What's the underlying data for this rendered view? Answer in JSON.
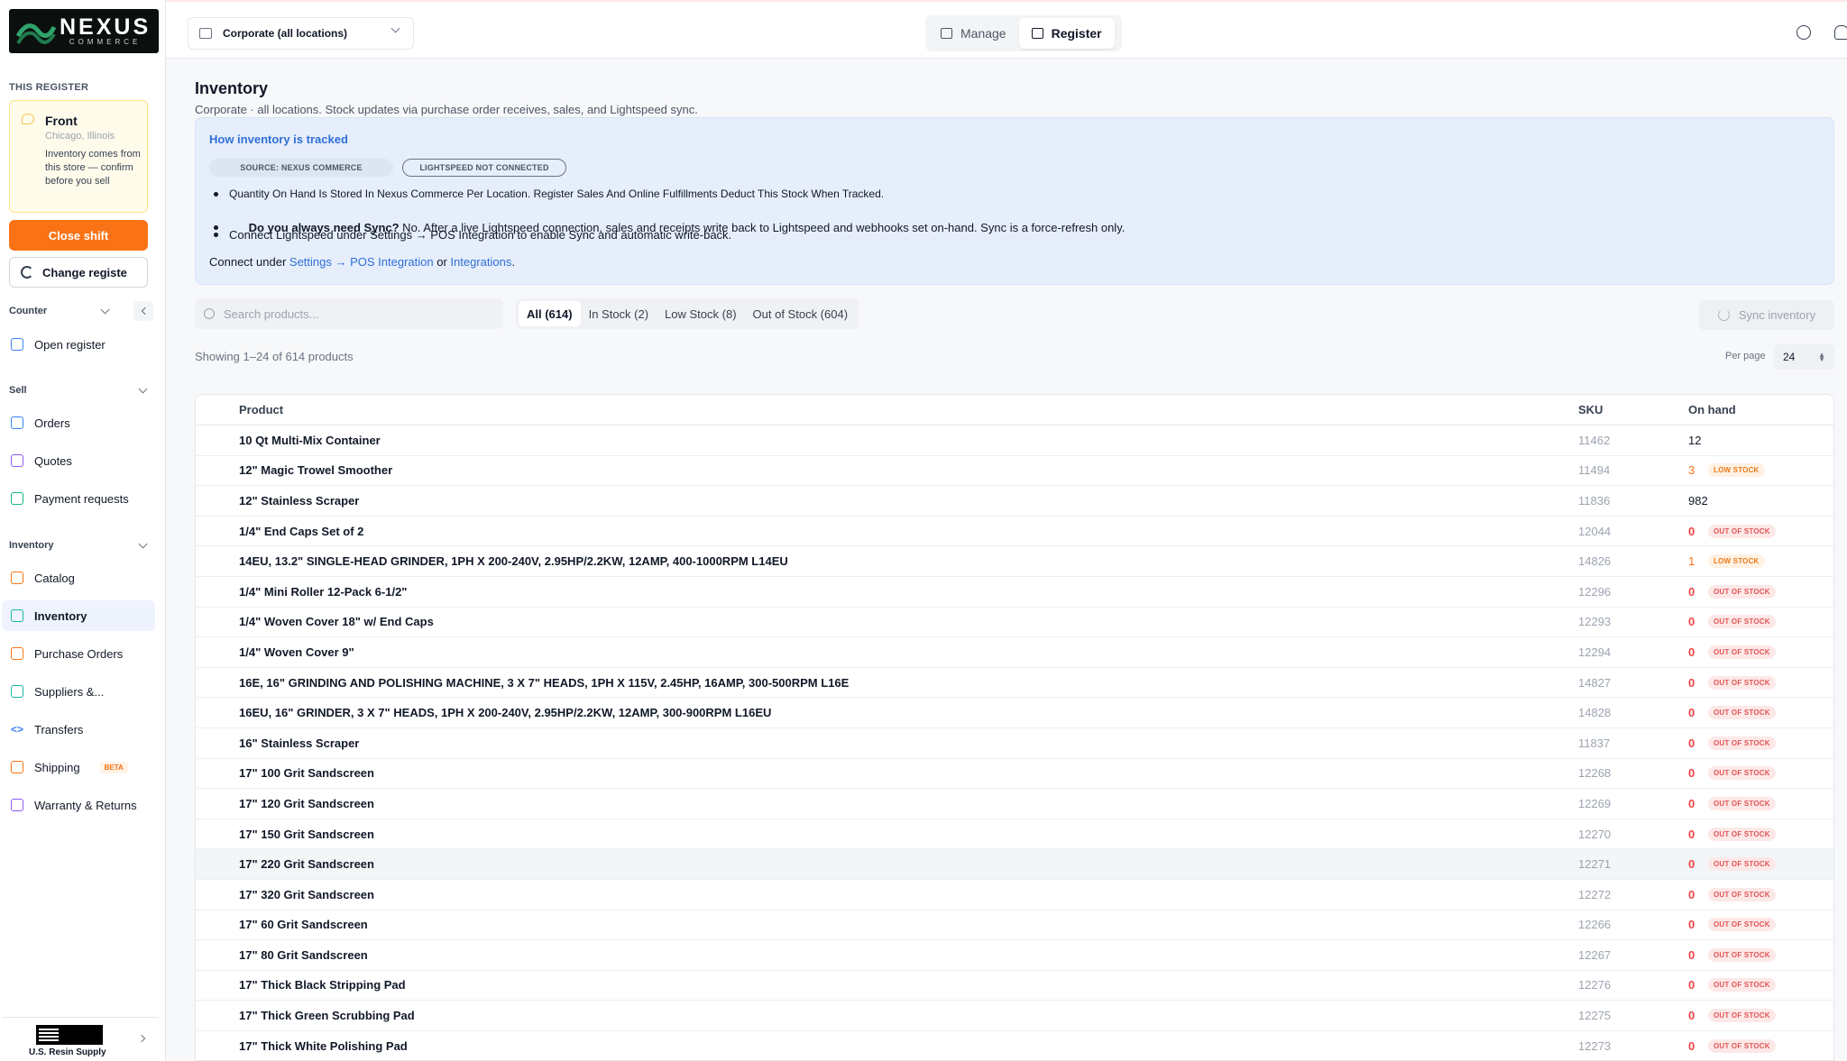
{
  "brand": {
    "name": "NEXUS",
    "sub": "COMMERCE"
  },
  "sidebar": {
    "this_register_label": "THIS REGISTER",
    "register": {
      "name": "Front",
      "location": "Chicago, Illinois",
      "note": "Inventory comes from this store — confirm before you sell"
    },
    "close_shift": "Close shift",
    "change_register": "Change registe",
    "groups": {
      "counter": "Counter",
      "sell": "Sell",
      "inventory": "Inventory"
    },
    "items": [
      {
        "label": "Open register"
      },
      {
        "label": "Orders"
      },
      {
        "label": "Quotes"
      },
      {
        "label": "Payment requests"
      },
      {
        "label": "Catalog"
      },
      {
        "label": "Inventory"
      },
      {
        "label": "Purchase Orders"
      },
      {
        "label": "Suppliers &..."
      },
      {
        "label": "Transfers"
      },
      {
        "label": "Shipping"
      },
      {
        "label": "Warranty & Returns"
      }
    ],
    "shipping_badge": "BETA",
    "company_name": "U.S. Resin Supply"
  },
  "topbar": {
    "location": "Corporate (all locations)",
    "modes": [
      "Manage",
      "Register"
    ],
    "active_mode": "Register"
  },
  "page": {
    "title": "Inventory",
    "subtitle": "Corporate · all locations. Stock updates via purchase order receives, sales, and Lightspeed sync."
  },
  "info": {
    "title": "How inventory is tracked",
    "chip_source": "SOURCE: NEXUS COMMERCE",
    "chip_lightspeed": "LIGHTSPEED NOT CONNECTED",
    "bullet1": "Quantity On Hand Is Stored In Nexus Commerce Per Location. Register Sales And Online Fulfillments Deduct This Stock When Tracked.",
    "bullet2_bold": "Do you always need Sync?",
    "bullet2_rest": " No. After a live Lightspeed connection, sales and receipts write back to Lightspeed and webhooks set on-hand. Sync is a force-refresh only.",
    "bullet3": "Connect Lightspeed under Settings → POS Integration to enable Sync and automatic write-back.",
    "connect_prefix": "Connect under ",
    "connect_link1": "Settings → POS Integration",
    "connect_or": " or ",
    "connect_link2": "Integrations",
    "connect_suffix": "."
  },
  "search": {
    "placeholder": "Search products..."
  },
  "filters": [
    "All (614)",
    "In Stock (2)",
    "Low Stock (8)",
    "Out of Stock (604)"
  ],
  "active_filter": "All (614)",
  "sync_label": "Sync inventory",
  "showing": "Showing 1–24 of 614 products",
  "per_page_label": "Per page",
  "per_page_value": "24",
  "table": {
    "headers": {
      "product": "Product",
      "sku": "SKU",
      "on_hand": "On hand"
    },
    "rows": [
      {
        "product": "10 Qt Multi-Mix Container",
        "sku": "11462",
        "qty": "12",
        "status": "ok",
        "badge": ""
      },
      {
        "product": "12\" Magic Trowel Smoother",
        "sku": "11494",
        "qty": "3",
        "status": "low",
        "badge": "LOW STOCK"
      },
      {
        "product": "12\" Stainless Scraper",
        "sku": "11836",
        "qty": "982",
        "status": "ok",
        "badge": ""
      },
      {
        "product": "1/4\" End Caps Set of 2",
        "sku": "12044",
        "qty": "0",
        "status": "out",
        "badge": "OUT OF STOCK"
      },
      {
        "product": "14EU, 13.2\" SINGLE-HEAD GRINDER, 1PH X 200-240V, 2.95HP/2.2KW, 12AMP, 400-1000RPM L14EU",
        "sku": "14826",
        "qty": "1",
        "status": "low",
        "badge": "LOW STOCK"
      },
      {
        "product": "1/4\" Mini Roller 12-Pack 6-1/2\"",
        "sku": "12296",
        "qty": "0",
        "status": "out",
        "badge": "OUT OF STOCK"
      },
      {
        "product": "1/4\" Woven Cover 18\" w/ End Caps",
        "sku": "12293",
        "qty": "0",
        "status": "out",
        "badge": "OUT OF STOCK"
      },
      {
        "product": "1/4\" Woven Cover 9\"",
        "sku": "12294",
        "qty": "0",
        "status": "out",
        "badge": "OUT OF STOCK"
      },
      {
        "product": "16E, 16\" GRINDING AND POLISHING MACHINE, 3 X 7\" HEADS, 1PH X 115V, 2.45HP, 16AMP, 300-500RPM L16E",
        "sku": "14827",
        "qty": "0",
        "status": "out",
        "badge": "OUT OF STOCK"
      },
      {
        "product": "16EU, 16\" GRINDER, 3 X 7\" HEADS, 1PH X 200-240V, 2.95HP/2.2KW, 12AMP, 300-900RPM L16EU",
        "sku": "14828",
        "qty": "0",
        "status": "out",
        "badge": "OUT OF STOCK"
      },
      {
        "product": "16\" Stainless Scraper",
        "sku": "11837",
        "qty": "0",
        "status": "out",
        "badge": "OUT OF STOCK"
      },
      {
        "product": "17\" 100 Grit Sandscreen",
        "sku": "12268",
        "qty": "0",
        "status": "out",
        "badge": "OUT OF STOCK"
      },
      {
        "product": "17\" 120 Grit Sandscreen",
        "sku": "12269",
        "qty": "0",
        "status": "out",
        "badge": "OUT OF STOCK"
      },
      {
        "product": "17\" 150 Grit Sandscreen",
        "sku": "12270",
        "qty": "0",
        "status": "out",
        "badge": "OUT OF STOCK"
      },
      {
        "product": "17\" 220 Grit Sandscreen",
        "sku": "12271",
        "qty": "0",
        "status": "out",
        "badge": "OUT OF STOCK"
      },
      {
        "product": "17\" 320 Grit Sandscreen",
        "sku": "12272",
        "qty": "0",
        "status": "out",
        "badge": "OUT OF STOCK"
      },
      {
        "product": "17\" 60 Grit Sandscreen",
        "sku": "12266",
        "qty": "0",
        "status": "out",
        "badge": "OUT OF STOCK"
      },
      {
        "product": "17\" 80 Grit Sandscreen",
        "sku": "12267",
        "qty": "0",
        "status": "out",
        "badge": "OUT OF STOCK"
      },
      {
        "product": "17\" Thick Black Stripping Pad",
        "sku": "12276",
        "qty": "0",
        "status": "out",
        "badge": "OUT OF STOCK"
      },
      {
        "product": "17\" Thick Green Scrubbing Pad",
        "sku": "12275",
        "qty": "0",
        "status": "out",
        "badge": "OUT OF STOCK"
      },
      {
        "product": "17\" Thick White Polishing Pad",
        "sku": "12273",
        "qty": "0",
        "status": "out",
        "badge": "OUT OF STOCK"
      }
    ]
  },
  "colors": {
    "accent_orange": "#f97316",
    "link_blue": "#2f6fd6",
    "out_red": "#ef4444"
  }
}
